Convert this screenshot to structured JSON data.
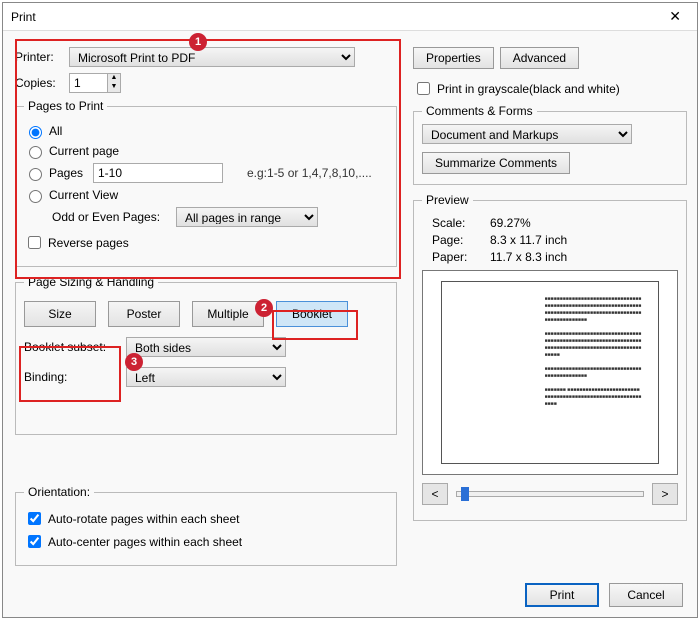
{
  "window": {
    "title": "Print"
  },
  "printer": {
    "label": "Printer:",
    "selected": "Microsoft Print to PDF",
    "copies_label": "Copies:",
    "copies_value": "1",
    "properties_btn": "Properties",
    "advanced_btn": "Advanced",
    "grayscale_label": "Print in grayscale(black and white)"
  },
  "pages_to_print": {
    "legend": "Pages to Print",
    "all": "All",
    "current_page": "Current page",
    "pages_label": "Pages",
    "pages_value": "1-10",
    "pages_hint": "e.g:1-5 or 1,4,7,8,10,....",
    "current_view": "Current View",
    "odd_even_label": "Odd or Even Pages:",
    "odd_even_value": "All pages in range",
    "reverse_pages": "Reverse pages"
  },
  "sizing": {
    "legend": "Page Sizing & Handling",
    "size": "Size",
    "poster": "Poster",
    "multiple": "Multiple",
    "booklet": "Booklet",
    "subset_label": "Booklet subset:",
    "subset_value": "Both sides",
    "binding_label": "Binding:",
    "binding_value": "Left"
  },
  "orientation": {
    "legend": "Orientation:",
    "auto_rotate": "Auto-rotate pages within each sheet",
    "auto_center": "Auto-center pages within each sheet"
  },
  "comments": {
    "legend": "Comments & Forms",
    "value": "Document and Markups",
    "summarize_btn": "Summarize Comments"
  },
  "preview": {
    "legend": "Preview",
    "scale_k": "Scale:",
    "scale_v": "69.27%",
    "page_k": "Page:",
    "page_v": "8.3 x 11.7 inch",
    "paper_k": "Paper:",
    "paper_v": "11.7 x 8.3 inch",
    "prev": "<",
    "next": ">"
  },
  "footer": {
    "print": "Print",
    "cancel": "Cancel"
  },
  "annotations": {
    "b1": "1",
    "b2": "2",
    "b3": "3"
  }
}
